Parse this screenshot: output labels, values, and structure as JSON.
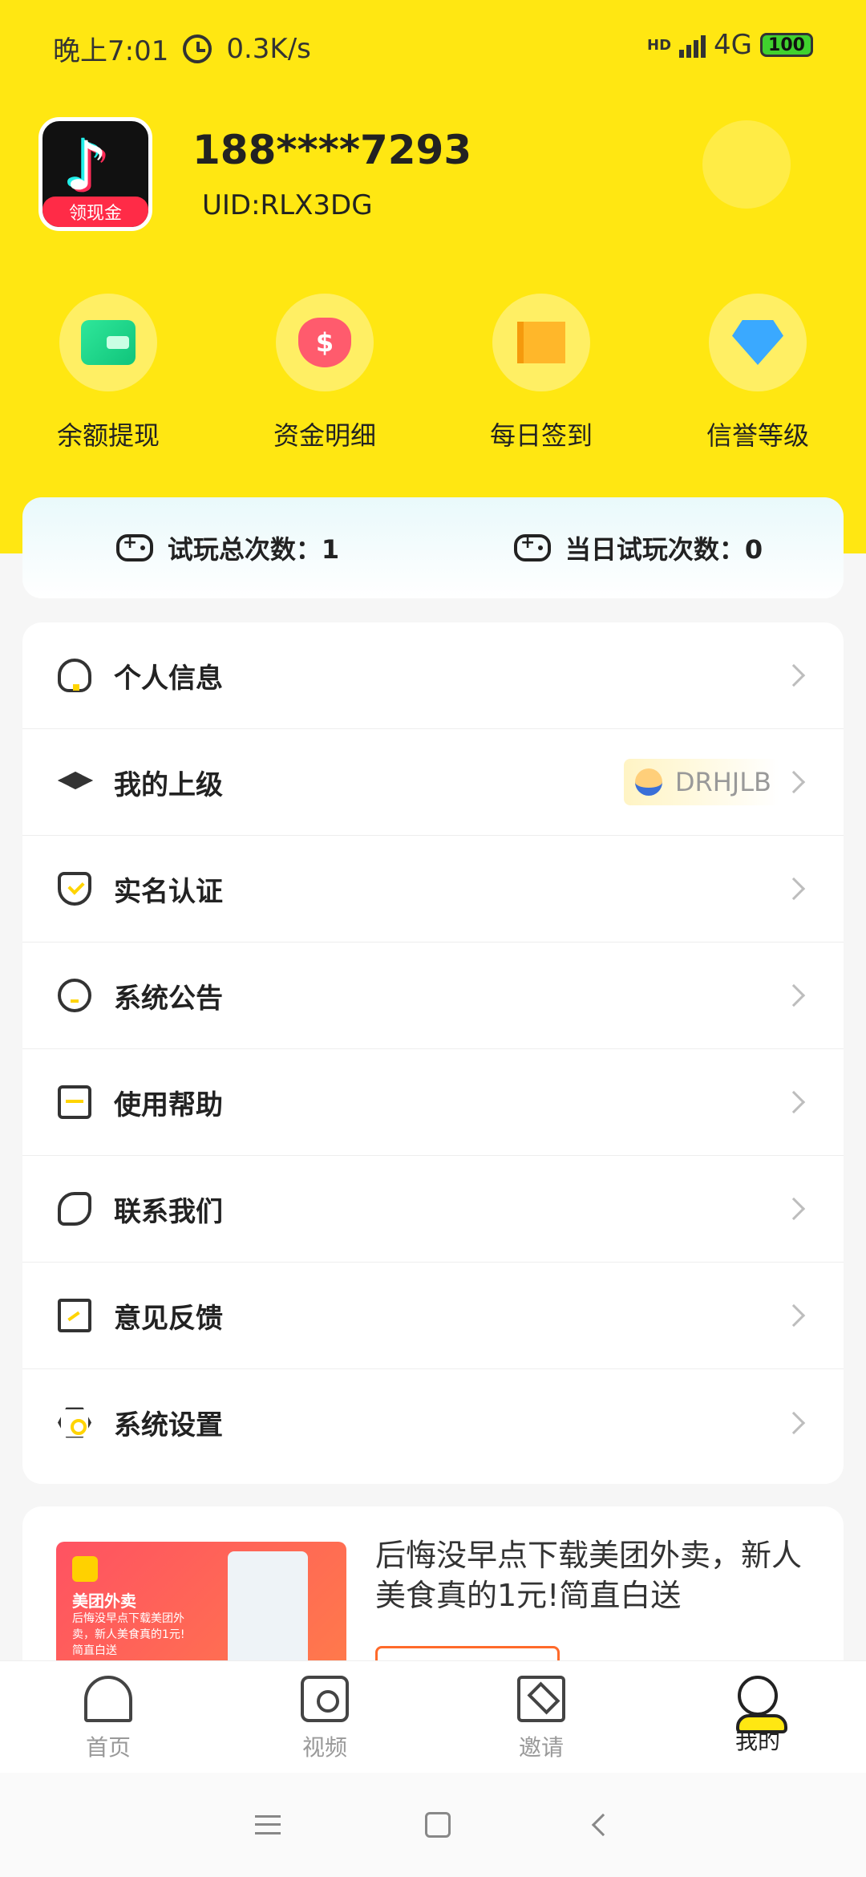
{
  "status_bar": {
    "time": "晚上7:01",
    "speed": "0.3K/s",
    "network": "4G",
    "hd": "HD",
    "battery": "100"
  },
  "profile": {
    "phone": "188****7293",
    "uid": "UID:RLX3DG",
    "avatar_badge": "领现金",
    "avatar_symbol": "♪"
  },
  "quick_actions": [
    {
      "label": "余额提现",
      "icon": "wallet-icon"
    },
    {
      "label": "资金明细",
      "icon": "money-bag-icon"
    },
    {
      "label": "每日签到",
      "icon": "flag-icon"
    },
    {
      "label": "信誉等级",
      "icon": "diamond-icon"
    }
  ],
  "trial_stats": {
    "total_label": "试玩总次数：1",
    "today_label": "当日试玩次数：0"
  },
  "menu": [
    {
      "label": "个人信息",
      "icon": "user-icon"
    },
    {
      "label": "我的上级",
      "icon": "graduation-cap-icon",
      "value": "DRHJLB"
    },
    {
      "label": "实名认证",
      "icon": "shield-check-icon"
    },
    {
      "label": "系统公告",
      "icon": "chat-bubble-icon"
    },
    {
      "label": "使用帮助",
      "icon": "help-icon"
    },
    {
      "label": "联系我们",
      "icon": "phone-icon"
    },
    {
      "label": "意见反馈",
      "icon": "edit-icon"
    },
    {
      "label": "系统设置",
      "icon": "settings-icon"
    }
  ],
  "ad": {
    "title": "后悔没早点下载美团外卖，新人美食真的1元!简直白送",
    "brand": "美团外卖",
    "copy": "后悔没早点下载美团外卖，新人美食真的1元!简直白送"
  },
  "bottom_nav": [
    {
      "label": "首页",
      "icon": "home-icon",
      "active": false
    },
    {
      "label": "视频",
      "icon": "video-icon",
      "active": false
    },
    {
      "label": "邀请",
      "icon": "invite-icon",
      "active": false
    },
    {
      "label": "我的",
      "icon": "profile-icon",
      "active": true
    }
  ],
  "colors": {
    "brand_yellow": "#ffe712",
    "chevron": "#bdbdbd"
  }
}
